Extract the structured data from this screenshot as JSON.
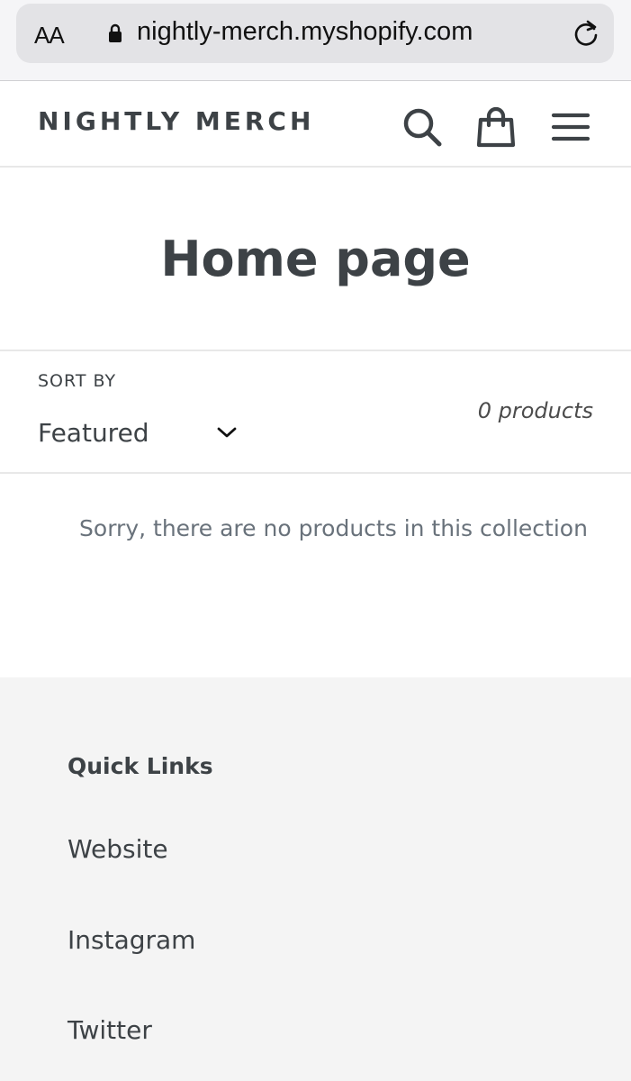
{
  "browser": {
    "text_size_label": "AA",
    "url": "nightly-merch.myshopify.com"
  },
  "store": {
    "name": "NIGHTLY MERCH"
  },
  "page": {
    "title": "Home page",
    "sort_label": "SORT BY",
    "sort_value": "Featured",
    "product_count": "0 products",
    "empty_message": "Sorry, there are no products in this collection"
  },
  "footer": {
    "heading": "Quick Links",
    "links": [
      "Website",
      "Instagram",
      "Twitter"
    ]
  },
  "icons": {
    "lock": "lock-icon",
    "reload": "reload-icon",
    "search": "search-icon",
    "cart": "cart-icon",
    "menu": "menu-icon",
    "chevron": "chevron-down-icon"
  },
  "colors": {
    "text": "#3d4246",
    "muted": "#69727b",
    "footer_bg": "#f4f4f4",
    "url_bar_bg": "#e3e3e6"
  }
}
